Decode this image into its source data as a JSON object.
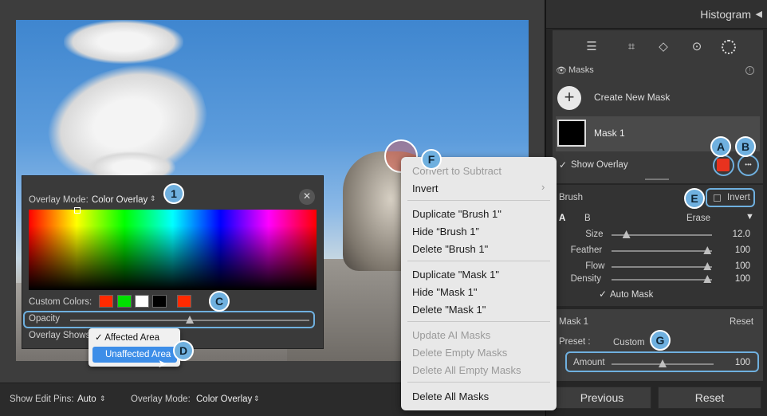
{
  "panel": {
    "header": "Histogram",
    "header_toggle": "◀",
    "masks_label": "Masks",
    "create_new_mask": "Create New Mask",
    "mask_name": "Mask 1",
    "show_overlay": "Show Overlay",
    "overlay_color": "#e8321e",
    "more": "•••",
    "brush_label": "Brush",
    "invert_label": "Invert",
    "tab_a": "A",
    "tab_b": "B",
    "erase": "Erase",
    "sliders": [
      {
        "label": "Size",
        "value": "12.0",
        "fraction": 0.15
      },
      {
        "label": "Feather",
        "value": "100",
        "fraction": 0.97
      },
      {
        "label": "Flow",
        "value": "100",
        "fraction": 0.97
      },
      {
        "label": "Density",
        "value": "100",
        "fraction": 0.97
      }
    ],
    "auto_mask": "Auto Mask",
    "mask1_title": "Mask 1",
    "reset_small": "Reset",
    "preset_label": "Preset :",
    "preset_value": "Custom",
    "amount_label": "Amount",
    "amount_value": "100",
    "amount_fraction": 0.5,
    "previous": "Previous",
    "reset": "Reset"
  },
  "bottombar": {
    "show_edit_pins_label": "Show Edit Pins:",
    "show_edit_pins_value": "Auto",
    "overlay_mode_label": "Overlay Mode:",
    "overlay_mode_value": "Color Overlay"
  },
  "overlay_panel": {
    "mode_label": "Overlay Mode:",
    "mode_value": "Color Overlay",
    "custom_colors_label": "Custom Colors:",
    "custom_colors": [
      "#ff2a00",
      "#00e000",
      "#ffffff",
      "#000000"
    ],
    "current_color": "#ff2a00",
    "opacity_label": "Opacity",
    "opacity_fraction": 0.5,
    "overlay_shows_label": "Overlay Shows:"
  },
  "dropdown": {
    "items": [
      {
        "label": "✓ Affected Area",
        "selected": false
      },
      {
        "label": "Unaffected Area",
        "selected": true
      }
    ]
  },
  "context_menu": {
    "items": [
      {
        "label": "Convert to Subtract",
        "disabled": true
      },
      {
        "label": "Invert",
        "disabled": false
      },
      {
        "label": "Duplicate \"Brush 1\"",
        "disabled": false
      },
      {
        "label": "Hide “Brush 1”",
        "disabled": false
      },
      {
        "label": "Delete \"Brush 1\"",
        "disabled": false
      },
      {
        "label": "Duplicate \"Mask 1\"",
        "disabled": false
      },
      {
        "label": "Hide \"Mask 1\"",
        "disabled": false
      },
      {
        "label": "Delete \"Mask 1\"",
        "disabled": false
      },
      {
        "label": "Update AI Masks",
        "disabled": true
      },
      {
        "label": "Delete Empty Masks",
        "disabled": true
      },
      {
        "label": "Delete All Empty Masks",
        "disabled": true
      },
      {
        "label": "Delete All Masks",
        "disabled": false
      }
    ]
  },
  "callouts": {
    "a": "A",
    "b": "B",
    "c": "C",
    "d": "D",
    "e": "E",
    "f": "F",
    "g": "G",
    "one": "1"
  }
}
